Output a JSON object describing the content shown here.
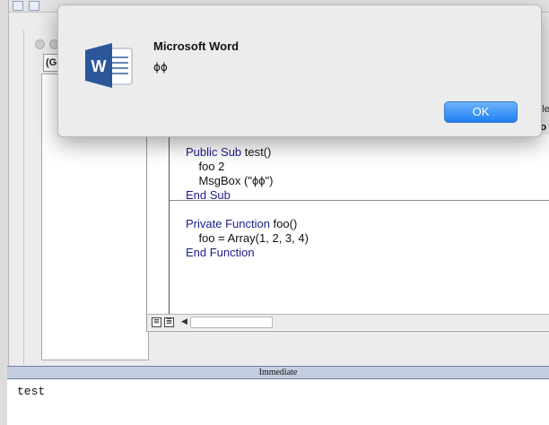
{
  "vbe": {
    "general_combo": "(Ge",
    "right_labels": {
      "module": "dule",
      "foo": "foo"
    },
    "code_lines": [
      {
        "tokens": [
          {
            "t": "Public Sub ",
            "kw": true
          },
          {
            "t": "test()",
            "kw": false
          }
        ]
      },
      {
        "tokens": [
          {
            "t": "    foo 2",
            "kw": false
          }
        ]
      },
      {
        "tokens": [
          {
            "t": "    MsgBox (\"ϕϕ\")",
            "kw": false
          }
        ]
      },
      {
        "tokens": [
          {
            "t": "End Sub",
            "kw": true
          }
        ]
      },
      {
        "tokens": [
          {
            "t": "",
            "kw": false
          }
        ]
      },
      {
        "tokens": [
          {
            "t": "Private Function ",
            "kw": true
          },
          {
            "t": "foo()",
            "kw": false
          }
        ]
      },
      {
        "tokens": [
          {
            "t": "    foo = Array(1, 2, 3, 4)",
            "kw": false
          }
        ]
      },
      {
        "tokens": [
          {
            "t": "End Function",
            "kw": true
          }
        ]
      }
    ],
    "immediate": {
      "title": "Immediate",
      "text": "test"
    }
  },
  "dialog": {
    "icon": "microsoft-word-icon",
    "title": "Microsoft Word",
    "message": "ϕϕ",
    "ok_label": "OK",
    "accent_color": "#1f7ff2"
  },
  "colors": {
    "keyword": "#1c1c8c",
    "immediate_title_bg": "#c5cee0"
  }
}
